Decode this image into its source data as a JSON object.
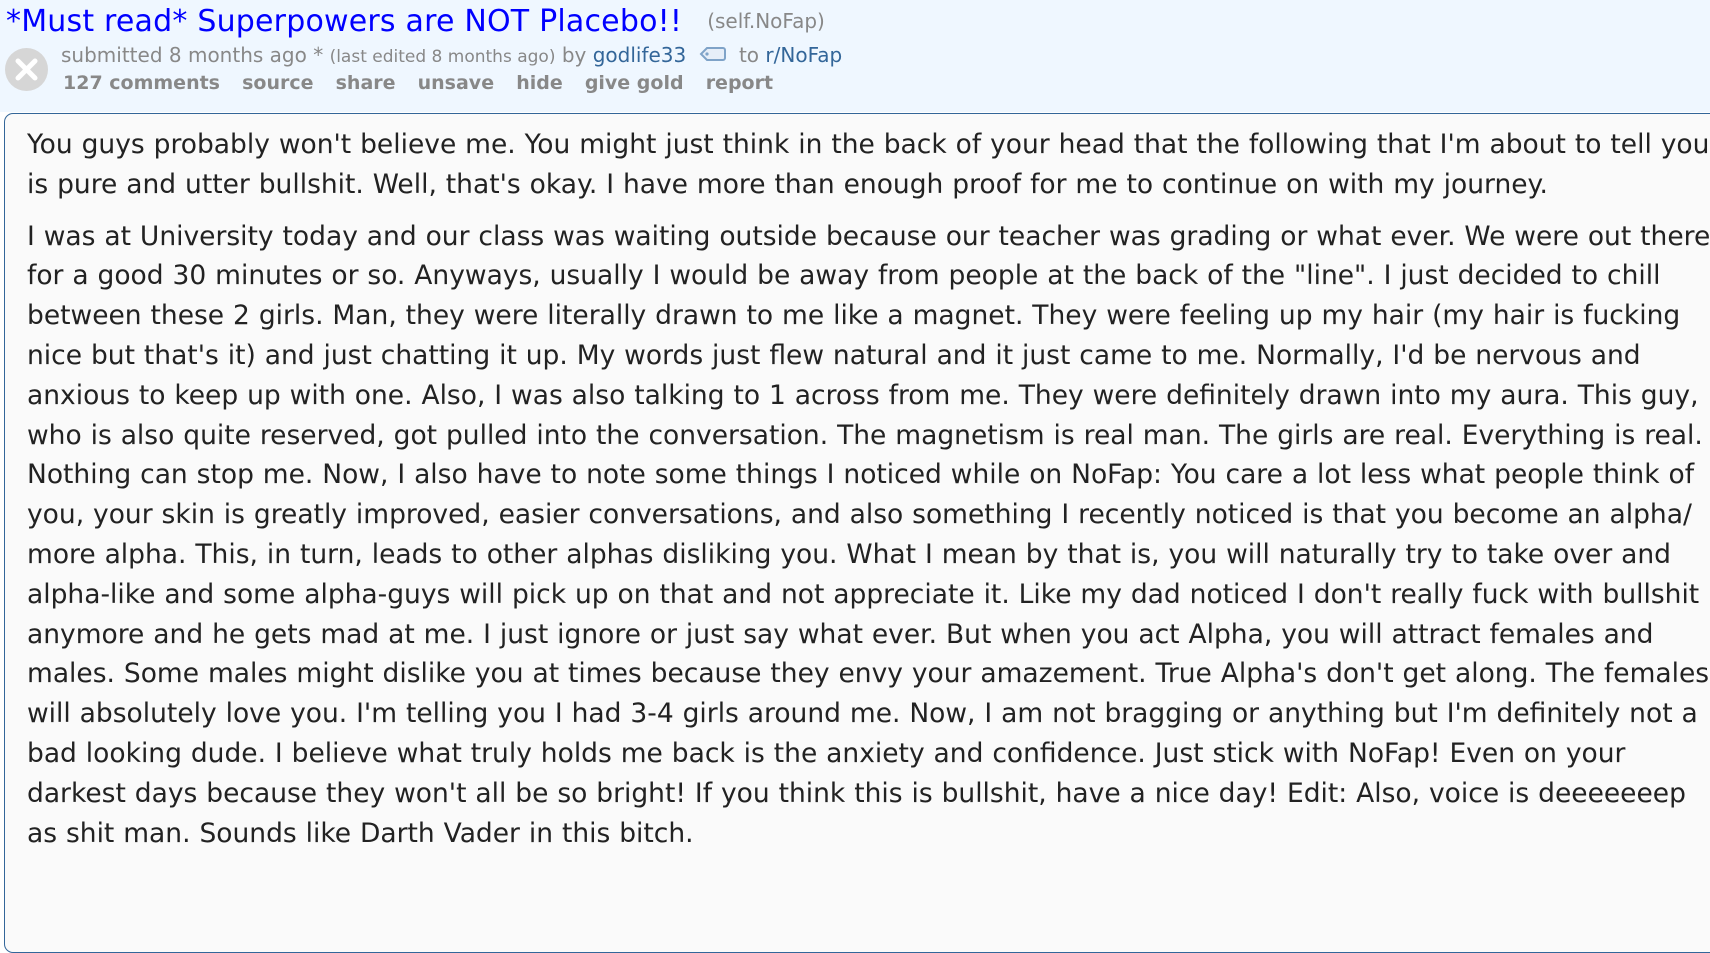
{
  "post": {
    "title": "*Must read* Superpowers are NOT Placebo!!",
    "domain": "(self.NoFap)",
    "close_icon": "x-circle-icon"
  },
  "tagline": {
    "submitted_prefix": "submitted",
    "submitted_age": "8 months ago",
    "edited_marker": "*",
    "edited_note": "(last edited 8 months ago)",
    "by": "by",
    "author": "godlife33",
    "tag_icon": "tag-icon",
    "to": "to",
    "subreddit": "r/NoFap"
  },
  "buttons": {
    "comments": "127 comments",
    "source": "source",
    "share": "share",
    "unsave": "unsave",
    "hide": "hide",
    "give_gold": "give gold",
    "report": "report"
  },
  "selftext": {
    "paragraphs": [
      "You guys probably won't believe me. You might just think in the back of your head that the following that I'm about to tell you is pure and utter bullshit. Well, that's okay. I have more than enough proof for me to continue on with my journey.",
      "I was at University today and our class was waiting outside because our teacher was grading or what ever. We were out there for a good 30 minutes or so. Anyways, usually I would be away from people at the back of the \"line\". I just decided to chill between these 2 girls. Man, they were literally drawn to me like a magnet. They were feeling up my hair (my hair is fucking nice but that's it) and just chatting it up. My words just flew natural and it just came to me. Normally, I'd be nervous and anxious to keep up with one. Also, I was also talking to 1 across from me. They were definitely drawn into my aura. This guy, who is also quite reserved, got pulled into the conversation. The magnetism is real man. The girls are real. Everything is real. Nothing can stop me. Now, I also have to note some things I noticed while on NoFap: You care a lot less what people think of you, your skin is greatly improved, easier conversations, and also something I recently noticed is that you become an alpha/ more alpha. This, in turn, leads to other alphas disliking you. What I mean by that is, you will naturally try to take over and alpha-like and some alpha-guys will pick up on that and not appreciate it. Like my dad noticed I don't really fuck with bullshit anymore and he gets mad at me. I just ignore or just say what ever. But when you act Alpha, you will attract females and males. Some males might dislike you at times because they envy your amazement. True Alpha's don't get along. The females will absolutely love you. I'm telling you I had 3-4 girls around me. Now, I am not bragging or anything but I'm definitely not a bad looking dude. I believe what truly holds me back is the anxiety and confidence. Just stick with NoFap! Even on your darkest days because they won't all be so bright! If you think this is bullshit, have a nice day! Edit: Also, voice is deeeeeeep as shit man. Sounds like Darth Vader in this bitch."
    ]
  },
  "colors": {
    "header_bg": "#eff7ff",
    "title_link": "#0000ff",
    "meta_gray": "#888888",
    "link_blue": "#336699",
    "body_text": "#222222",
    "selftext_border": "#336699"
  }
}
